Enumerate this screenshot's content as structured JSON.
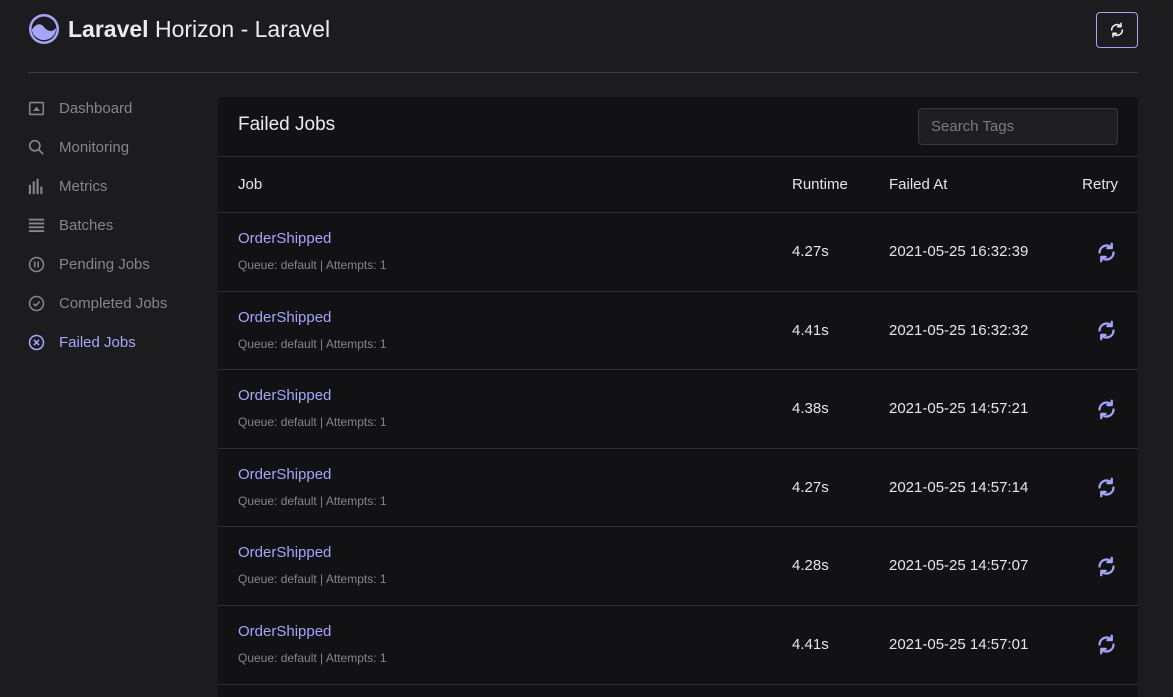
{
  "app": {
    "title_bold": "Laravel",
    "title_rest": " Horizon - Laravel",
    "accent_color": "#a5a5ff"
  },
  "header": {
    "refresh_icon": "refresh-icon"
  },
  "sidebar": {
    "items": [
      {
        "label": "Dashboard",
        "icon": "dashboard-icon",
        "active": false
      },
      {
        "label": "Monitoring",
        "icon": "search-icon",
        "active": false
      },
      {
        "label": "Metrics",
        "icon": "bar-chart-icon",
        "active": false
      },
      {
        "label": "Batches",
        "icon": "list-icon",
        "active": false
      },
      {
        "label": "Pending Jobs",
        "icon": "pause-circle-icon",
        "active": false
      },
      {
        "label": "Completed Jobs",
        "icon": "check-circle-icon",
        "active": false
      },
      {
        "label": "Failed Jobs",
        "icon": "x-circle-icon",
        "active": true
      }
    ]
  },
  "main": {
    "title": "Failed Jobs",
    "search": {
      "placeholder": "Search Tags",
      "value": ""
    },
    "columns": {
      "job": "Job",
      "runtime": "Runtime",
      "failed_at": "Failed At",
      "retry": "Retry"
    },
    "rows": [
      {
        "job": "OrderShipped",
        "meta": "Queue: default | Attempts: 1",
        "runtime": "4.27s",
        "failed_at": "2021-05-25 16:32:39"
      },
      {
        "job": "OrderShipped",
        "meta": "Queue: default | Attempts: 1",
        "runtime": "4.41s",
        "failed_at": "2021-05-25 16:32:32"
      },
      {
        "job": "OrderShipped",
        "meta": "Queue: default | Attempts: 1",
        "runtime": "4.38s",
        "failed_at": "2021-05-25 14:57:21"
      },
      {
        "job": "OrderShipped",
        "meta": "Queue: default | Attempts: 1",
        "runtime": "4.27s",
        "failed_at": "2021-05-25 14:57:14"
      },
      {
        "job": "OrderShipped",
        "meta": "Queue: default | Attempts: 1",
        "runtime": "4.28s",
        "failed_at": "2021-05-25 14:57:07"
      },
      {
        "job": "OrderShipped",
        "meta": "Queue: default | Attempts: 1",
        "runtime": "4.41s",
        "failed_at": "2021-05-25 14:57:01"
      }
    ]
  }
}
